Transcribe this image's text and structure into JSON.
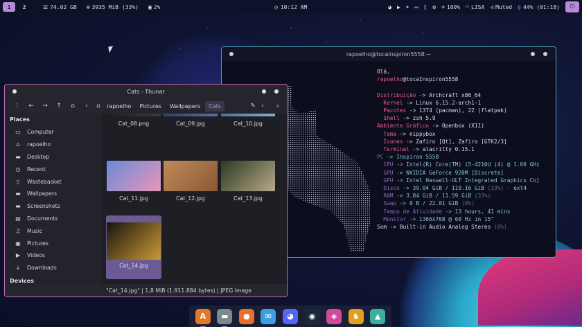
{
  "top_panel": {
    "workspaces": [
      "1",
      "2"
    ],
    "disk": "74.02 GB",
    "memory": "3935 MiB (33%)",
    "cpu": "2%",
    "clock": "10:12 AM",
    "wifi": "100%",
    "network": "LISA",
    "volume": "Muted",
    "battery": "44% (01:18)"
  },
  "terminal": {
    "title": "rapoelho@tocaInspiron5558:~",
    "greeting": "Olá,",
    "user": "rapoelho",
    "host": "@tocaInspiron5558",
    "lines": [
      {
        "key": "Distribuição",
        "indent": "",
        "val": " -> Archcraft x86_64",
        "kc": "k-red"
      },
      {
        "key": "Kernel",
        "indent": "  ",
        "val": " -> Linux 6.15.2-arch1-1",
        "kc": "k-red"
      },
      {
        "key": "Pacotes",
        "indent": "  ",
        "val": " -> 1374 (pacman), 22 (flatpak)",
        "kc": "k-red"
      },
      {
        "key": "Shell",
        "indent": "  ",
        "val": " -> zsh 5.9",
        "kc": "k-red"
      },
      {
        "key": "Ambiente Gráfico",
        "indent": "",
        "val": " -> Openbox (X11)",
        "kc": "k-red"
      },
      {
        "key": "Tema",
        "indent": "  ",
        "val": " -> nippybox",
        "kc": "k-red"
      },
      {
        "key": "Ícones",
        "indent": "  ",
        "val": " -> Zafiro [Qt], Zafiro [GTK2/3]",
        "kc": "k-red"
      },
      {
        "key": "Terminal",
        "indent": "  ",
        "val": " -> alacritty 0.15.1",
        "kc": "k-red"
      },
      {
        "key": "PC",
        "indent": "",
        "val": " -> Inspiron 5558",
        "kc": "k-dim"
      },
      {
        "key": "CPU",
        "indent": "  ",
        "val": " -> Intel(R) Core(TM) i5-4210U (4) @ 1.60 GHz",
        "kc": "k-dim"
      },
      {
        "key": "GPU",
        "indent": "  ",
        "val": " -> NVIDIA GeForce 920M [Discrete]",
        "kc": "k-dim"
      },
      {
        "key": "GPU",
        "indent": "  ",
        "val": " -> Intel Haswell-ULT Integrated Graphics Co]",
        "kc": "k-dim"
      },
      {
        "key": "Disco",
        "indent": "  ",
        "val": " -> 39.04 GiB / 119.16 GiB ",
        "pct": "(33%)",
        "tail": " - ext4",
        "kc": "k-dim"
      },
      {
        "key": "RAM",
        "indent": "  ",
        "val": " -> 3.84 GiB / 11.59 GiB ",
        "pct": "(33%)",
        "tail": "",
        "kc": "k-dim"
      },
      {
        "key": "Swap",
        "indent": "  ",
        "val": " -> 0 B / 22.01 GiB ",
        "pct": "(0%)",
        "tail": "",
        "kc": "k-dim"
      },
      {
        "key": "Tempo de Atividade",
        "indent": "  ",
        "val": " -> 13 hours, 41 mins",
        "kc": "k-dim"
      },
      {
        "key": "Monitor",
        "indent": "  ",
        "val": " -> 1366x768 @ 60 Hz in 15\"",
        "kc": "k-dim"
      },
      {
        "key": "Som",
        "indent": "",
        "val": " -> Built-in Audio Analog Stereo ",
        "pct": "(0%)",
        "tail": "",
        "kc": "v-w"
      }
    ]
  },
  "thunar": {
    "title": "Cats - Thunar",
    "breadcrumbs": [
      "rapoelho",
      "Pictures",
      "Wallpapers",
      "Cats"
    ],
    "places_header": "Places",
    "places": [
      {
        "label": "Computer",
        "icon": "computer-icon",
        "glyph": "▭"
      },
      {
        "label": "rapoelho",
        "icon": "home-icon",
        "glyph": "⌂"
      },
      {
        "label": "Desktop",
        "icon": "desktop-folder-icon",
        "glyph": "▬"
      },
      {
        "label": "Recent",
        "icon": "clock-icon",
        "glyph": "◷"
      },
      {
        "label": "Wastebasket",
        "icon": "trash-icon",
        "glyph": "▯"
      },
      {
        "label": "Wallpapers",
        "icon": "folder-icon",
        "glyph": "▬"
      },
      {
        "label": "Screenshots",
        "icon": "folder-icon",
        "glyph": "▬"
      },
      {
        "label": "Documents",
        "icon": "document-icon",
        "glyph": "▤"
      },
      {
        "label": "Music",
        "icon": "music-icon",
        "glyph": "♫"
      },
      {
        "label": "Pictures",
        "icon": "pictures-icon",
        "glyph": "▣"
      },
      {
        "label": "Videos",
        "icon": "videos-icon",
        "glyph": "▶"
      },
      {
        "label": "Downloads",
        "icon": "download-icon",
        "glyph": "↓"
      }
    ],
    "devices_header": "Devices",
    "files": [
      {
        "name": "Cat_08.png",
        "colors": [
          "#1a1a1a",
          "#3a3a40"
        ]
      },
      {
        "name": "Cat_09.jpg",
        "colors": [
          "#2b3660",
          "#5a6ea8"
        ]
      },
      {
        "name": "Cat_10.jpg",
        "colors": [
          "#3a6a9a",
          "#8ab0d0"
        ]
      },
      {
        "name": "Cat_11.jpg",
        "colors": [
          "#6a8ad8",
          "#e896b8"
        ]
      },
      {
        "name": "Cat_12.jpg",
        "colors": [
          "#c08a5a",
          "#8a5a34"
        ]
      },
      {
        "name": "Cat_13.jpg",
        "colors": [
          "#2a3a22",
          "#b8a888"
        ]
      },
      {
        "name": "Cat_14.jpg",
        "colors": [
          "#1a140e",
          "#c89a38"
        ]
      }
    ],
    "status": "\"Cat_14.jpg\"  |  1,8 MiB (1.911.884 bytes)  |  JPEG image"
  },
  "dock": [
    {
      "name": "alacritty-app",
      "glyph": "A",
      "bg": "#e07a2a",
      "running": true
    },
    {
      "name": "files-app",
      "glyph": "▬",
      "bg": "#7a8a8a",
      "running": true
    },
    {
      "name": "firefox-app",
      "glyph": "●",
      "bg": "#e8702a",
      "running": false
    },
    {
      "name": "messenger-app",
      "glyph": "✉",
      "bg": "#3aa0e0",
      "running": false
    },
    {
      "name": "discord-app",
      "glyph": "◕",
      "bg": "#5865f2",
      "running": false
    },
    {
      "name": "steam-app",
      "glyph": "◉",
      "bg": "#1b2838",
      "running": false
    },
    {
      "name": "browser-app",
      "glyph": "◈",
      "bg": "#d04a9a",
      "running": false
    },
    {
      "name": "game-app",
      "glyph": "♞",
      "bg": "#e0a020",
      "running": false
    },
    {
      "name": "image-viewer-app",
      "glyph": "▲",
      "bg": "#3ab0a0",
      "running": false
    }
  ]
}
